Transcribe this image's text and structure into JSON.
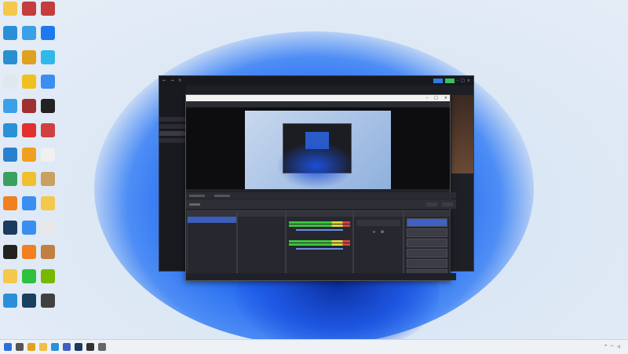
{
  "overlay": {
    "lines": [
      "",
      "",
      "",
      "",
      ""
    ]
  },
  "desktop": {
    "icons": [
      {
        "label": "",
        "icon": "folder-icon",
        "color": "#f4c84a"
      },
      {
        "label": "",
        "icon": "archive-icon",
        "color": "#c43c3c"
      },
      {
        "label": "",
        "icon": "archive-icon",
        "color": "#c43c3c"
      },
      {
        "label": "",
        "icon": "monitor-icon",
        "color": "#2b8fd8"
      },
      {
        "label": "",
        "icon": "phone-icon",
        "color": "#3aa0e8"
      },
      {
        "label": "",
        "icon": "messenger-icon",
        "color": "#1e78f0"
      },
      {
        "label": "",
        "icon": "network-icon",
        "color": "#2a8fd0"
      },
      {
        "label": "",
        "icon": "chrome-icon",
        "color": "#e0a020"
      },
      {
        "label": "",
        "icon": "app-icon",
        "color": "#2fb8e8"
      },
      {
        "label": "",
        "icon": "recycle-bin-icon",
        "color": "#dfe7ef"
      },
      {
        "label": "",
        "icon": "app-icon",
        "color": "#f0c020"
      },
      {
        "label": "",
        "icon": "play-icon",
        "color": "#3a8ef0"
      },
      {
        "label": "",
        "icon": "monitor-icon",
        "color": "#3aa0e8"
      },
      {
        "label": "",
        "icon": "app-icon",
        "color": "#a03030"
      },
      {
        "label": "",
        "icon": "qr-icon",
        "color": "#222"
      },
      {
        "label": "",
        "icon": "edge-icon",
        "color": "#2a90d8"
      },
      {
        "label": "",
        "icon": "app-icon",
        "color": "#e03030"
      },
      {
        "label": "",
        "icon": "calendar-icon",
        "color": "#d04040"
      },
      {
        "label": "",
        "icon": "app-icon",
        "color": "#2a80d0"
      },
      {
        "label": "",
        "icon": "fire-icon",
        "color": "#f0a020"
      },
      {
        "label": "",
        "icon": "doc-icon",
        "color": "#f0f0f0"
      },
      {
        "label": "",
        "icon": "globe-icon",
        "color": "#3aa060"
      },
      {
        "label": "",
        "icon": "app-icon",
        "color": "#f0c030"
      },
      {
        "label": "",
        "icon": "folder-icon",
        "color": "#c8a060"
      },
      {
        "label": "",
        "icon": "app-icon",
        "color": "#f08020"
      },
      {
        "label": "",
        "icon": "play-icon",
        "color": "#3a8ef0"
      },
      {
        "label": "",
        "icon": "folder-icon",
        "color": "#f4c84a"
      },
      {
        "label": "",
        "icon": "steam-icon",
        "color": "#1a3a60"
      },
      {
        "label": "",
        "icon": "play-icon",
        "color": "#3a8ef0"
      },
      {
        "label": "",
        "icon": "cloud-icon",
        "color": "#e8e8e8"
      },
      {
        "label": "",
        "icon": "obs-icon",
        "color": "#222"
      },
      {
        "label": "",
        "icon": "vlc-icon",
        "color": "#f08020"
      },
      {
        "label": "",
        "icon": "app-icon",
        "color": "#c08040"
      },
      {
        "label": "",
        "icon": "folder-icon",
        "color": "#f4c84a"
      },
      {
        "label": "",
        "icon": "wechat-icon",
        "color": "#30c040"
      },
      {
        "label": "",
        "icon": "nvidia-icon",
        "color": "#76b900"
      },
      {
        "label": "",
        "icon": "app-icon",
        "color": "#2a8fd8"
      },
      {
        "label": "",
        "icon": "app-icon",
        "color": "#1a4060"
      },
      {
        "label": "",
        "icon": "app-icon",
        "color": "#404040"
      }
    ]
  },
  "obs": {
    "title": "",
    "menu": [
      "",
      "",
      "",
      "",
      ""
    ],
    "scenes_header": "",
    "sources_header": "",
    "mixer_header": "",
    "transitions_header": "",
    "controls_header": "",
    "scenes": [
      "",
      ""
    ],
    "sources": [
      "",
      "",
      "",
      "",
      "",
      "",
      ""
    ],
    "controls": [
      "",
      "",
      "",
      "",
      "",
      ""
    ],
    "status": [
      "",
      "",
      "",
      "",
      ""
    ]
  },
  "taskbar": {
    "icons": [
      "windows-icon",
      "search-icon",
      "chrome-icon",
      "file-explorer-icon",
      "edge-icon",
      "store-icon",
      "steam-icon",
      "obs-icon",
      "app-icon"
    ],
    "time": "",
    "date": ""
  }
}
